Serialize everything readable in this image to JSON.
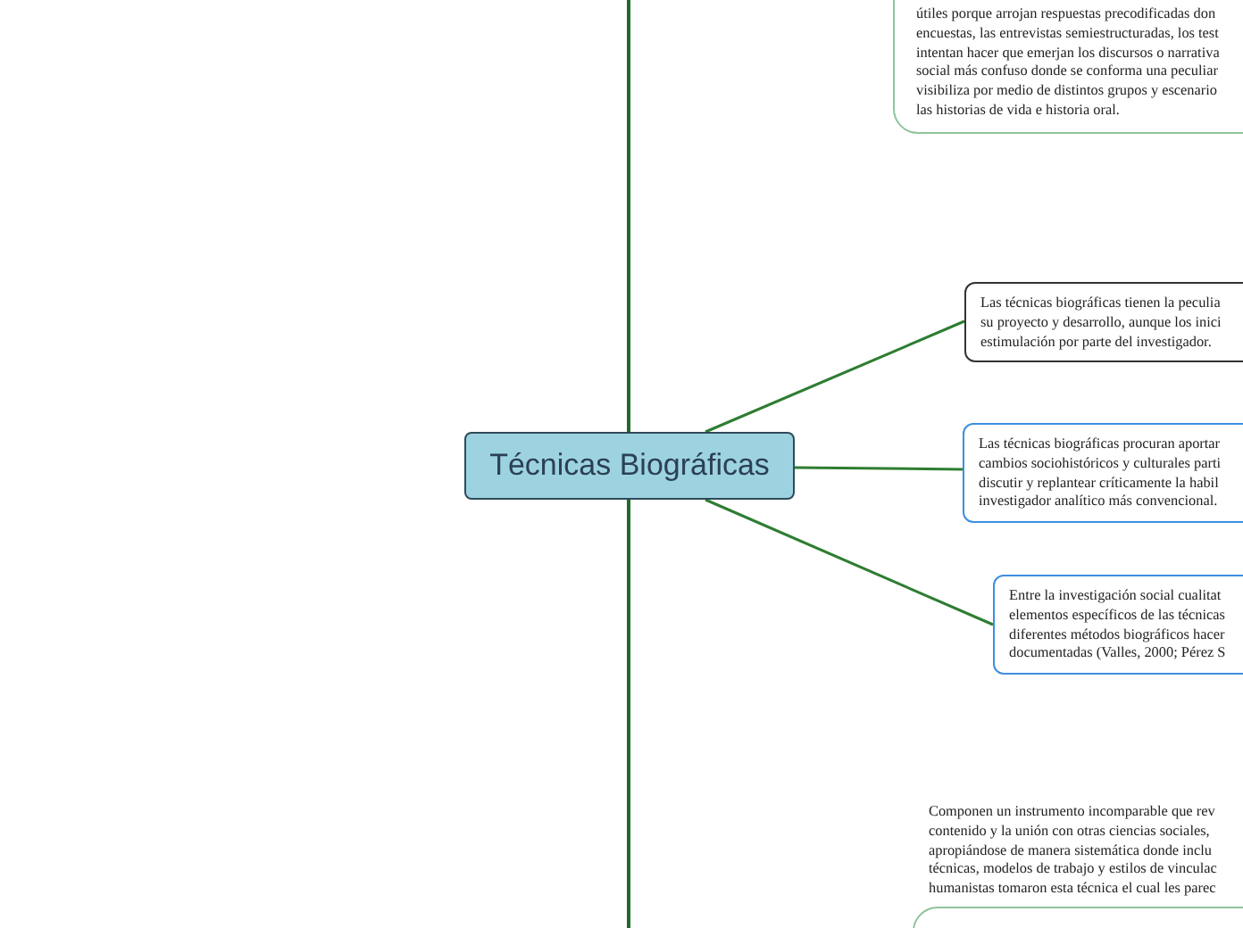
{
  "central_topic": {
    "label": "Técnicas Biográficas"
  },
  "nodes": [
    {
      "kind": "boxed",
      "color": "#8fc49a",
      "lines": [
        "útiles porque arrojan respuestas precodificadas don",
        "encuestas, las entrevistas semiestructuradas, los test",
        "intentan hacer que emerjan los discursos o narrativa",
        "social más confuso donde se conforma una peculiar",
        "visibiliza por medio de distintos grupos y escenario",
        "las historias de vida e historia oral."
      ]
    },
    {
      "kind": "boxed",
      "color": "#333333",
      "lines": [
        "Las técnicas biográficas tienen la peculia",
        "su proyecto y desarrollo, aunque los inici",
        "estimulación por parte del investigador."
      ]
    },
    {
      "kind": "boxed",
      "color": "#3d8fe0",
      "lines": [
        "Las técnicas biográficas procuran aportar",
        "cambios sociohistóricos y culturales parti",
        "discutir y replantear críticamente la habil",
        "investigador analítico más convencional."
      ]
    },
    {
      "kind": "boxed",
      "color": "#3d8fe0",
      "lines": [
        "Entre la investigación social cualitat",
        "elementos específicos de las técnicas",
        "diferentes métodos biográficos hacer",
        "documentadas (Valles, 2000; Pérez S"
      ]
    },
    {
      "kind": "plain",
      "lines": [
        "Componen un instrumento incomparable que rev",
        "contenido y la unión con otras ciencias sociales,",
        "apropiándose de manera sistemática donde inclu",
        "técnicas, modelos de trabajo y estilos de vinculac",
        "humanistas tomaron esta técnica el cual les parec"
      ]
    }
  ]
}
